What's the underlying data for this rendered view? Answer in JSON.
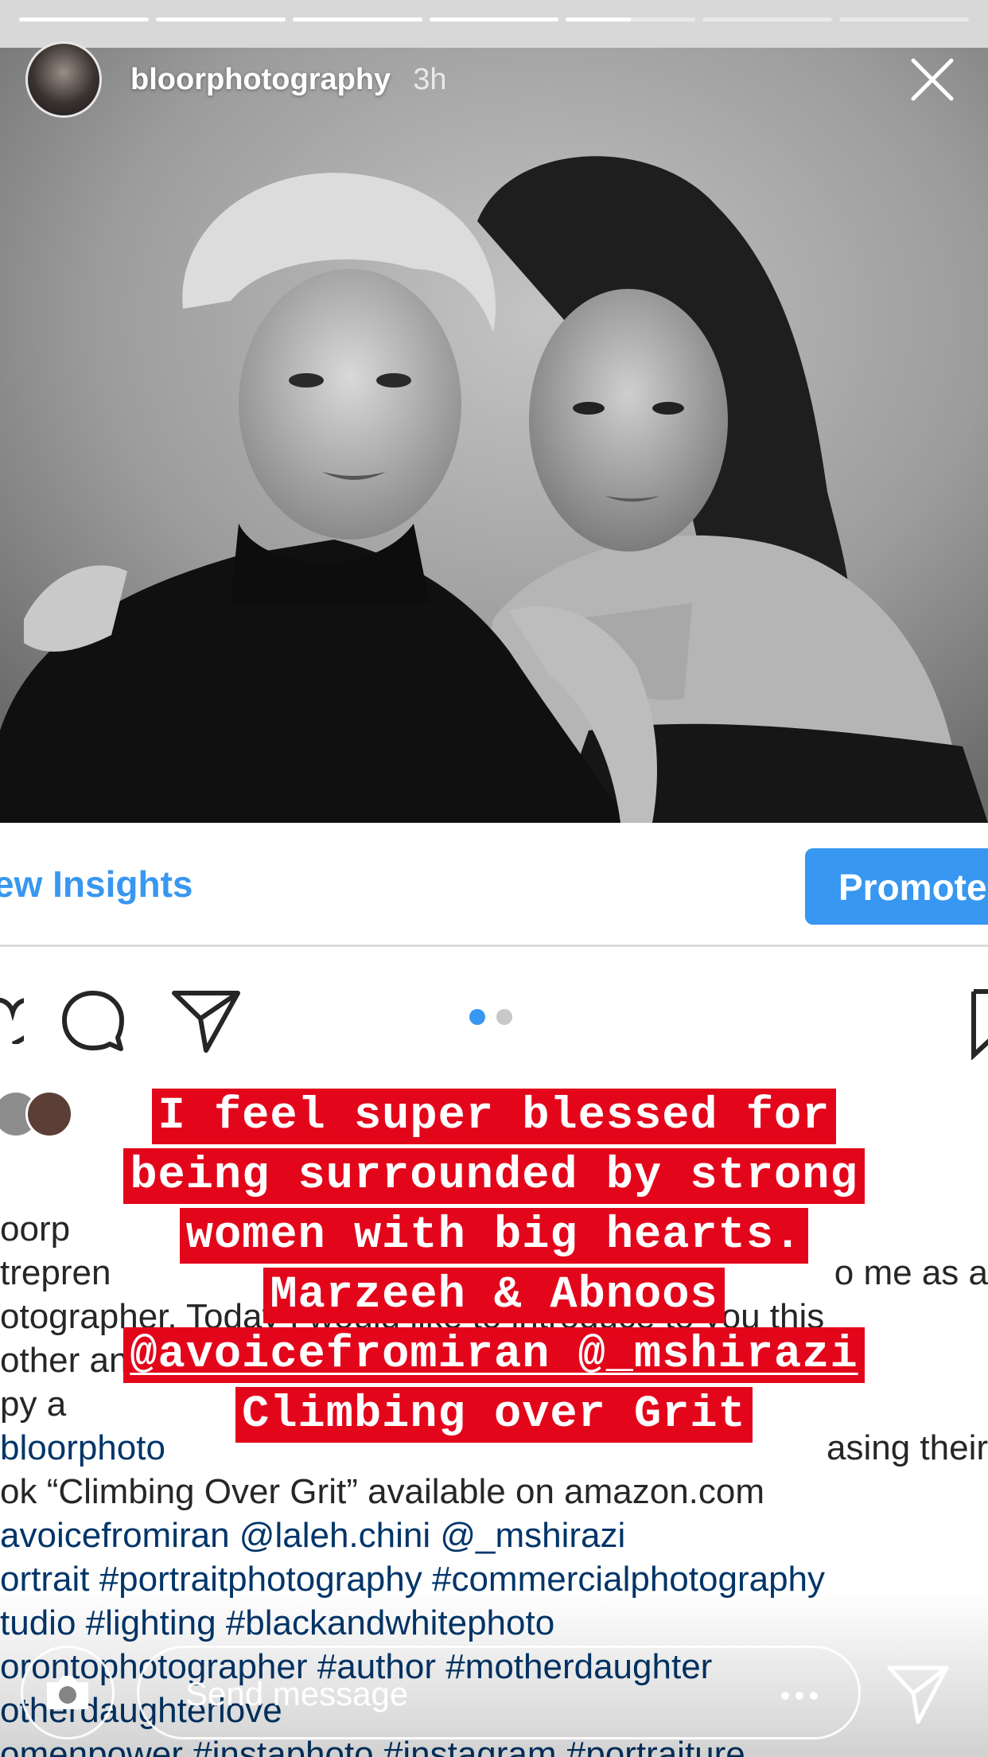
{
  "story": {
    "progress_segments": [
      1.0,
      1.0,
      1.0,
      1.0,
      0.5,
      0.0,
      0.0
    ],
    "header": {
      "username": "bloorphotography",
      "time": "3h",
      "avatar_icon": "profile-avatar",
      "close_icon": "close-icon"
    },
    "photo": {
      "style": "black-and-white portrait"
    }
  },
  "post": {
    "insights_link": "ew Insights",
    "promote_button": "Promote",
    "action_icons": [
      "heart-icon",
      "comment-icon",
      "share-icon",
      "bookmark-icon"
    ],
    "carousel": {
      "count": 2,
      "active": 0
    },
    "caption_lines": [
      {
        "text": "",
        "link": false
      },
      {
        "text": "oorp",
        "link": false
      },
      {
        "text": "trepren",
        "tail": "o me as a",
        "link": false
      },
      {
        "text": "otographer. Today I would like to introduce to you this",
        "link": false
      },
      {
        "text": "other and daughter whose book is now available in hard",
        "link": false
      },
      {
        "text": "py a",
        "link": false
      },
      {
        "text": "bloorphoto",
        "tail": "asing their",
        "link": true
      },
      {
        "text": "ok “Climbing Over Grit” available on amazon.com",
        "link": false
      },
      {
        "text": "avoicefromiran @laleh.chini @_mshirazi",
        "link": true
      },
      {
        "text": "ortrait #portraitphotography #commercialphotography",
        "link": true
      },
      {
        "text": "tudio #lighting #blackandwhitephoto",
        "link": true
      },
      {
        "text": "orontophotographer #author #motherdaughter",
        "link": true
      },
      {
        "text": "otherdaughterlove",
        "link": true
      },
      {
        "text": "omenpower #instaphoto #instagram #portraiture",
        "link": true
      }
    ]
  },
  "overlay": {
    "lines": [
      {
        "text": "I feel super blessed for",
        "underline": false
      },
      {
        "text": "being surrounded by strong",
        "underline": false
      },
      {
        "text": "women with big hearts.",
        "underline": false
      },
      {
        "text": "Marzeeh & Abnoos",
        "underline": false
      },
      {
        "text": "@avoicefromiran @_mshirazi",
        "underline": true
      },
      {
        "text": "Climbing over Grit",
        "underline": false
      }
    ],
    "highlight_color": "#e3061b"
  },
  "reply_bar": {
    "placeholder": "Send message",
    "camera_icon": "camera-icon",
    "more_icon": "more-dots-icon",
    "send_icon": "send-icon"
  }
}
